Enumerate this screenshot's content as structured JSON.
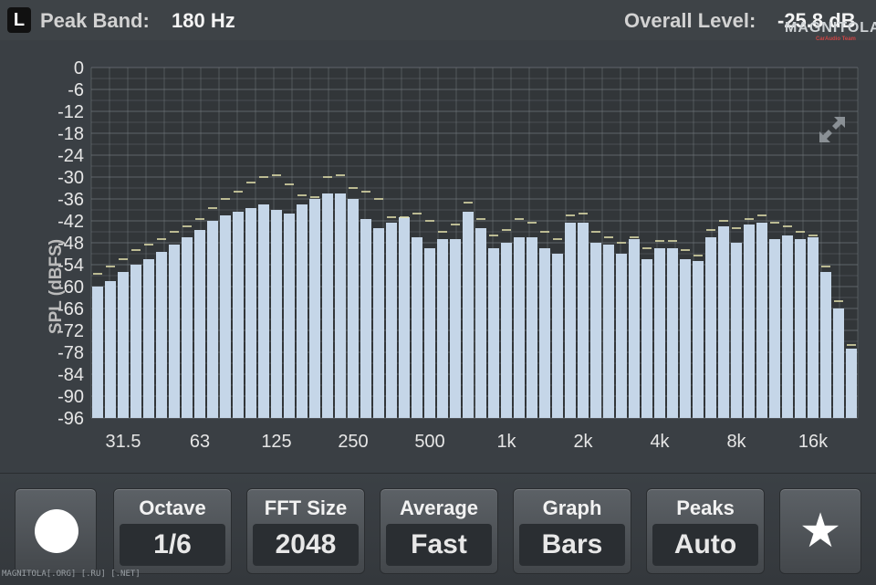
{
  "header": {
    "channel": "L",
    "peak_label": "Peak Band:",
    "peak_value": "180 Hz",
    "level_label": "Overall Level:",
    "level_value": "-25.8 dB",
    "watermark": "MAGNITOLA",
    "watermark_sub": "CarAudio Team"
  },
  "chart_data": {
    "type": "bar",
    "ylabel": "SPL (dBFS)",
    "ylim": [
      -96,
      0
    ],
    "y_ticks": [
      0,
      -6,
      -12,
      -18,
      -24,
      -30,
      -36,
      -42,
      -48,
      -54,
      -60,
      -66,
      -72,
      -78,
      -84,
      -90,
      -96
    ],
    "x_tick_labels": [
      "31.5",
      "63",
      "125",
      "250",
      "500",
      "1k",
      "2k",
      "4k",
      "8k",
      "16k"
    ],
    "x_tick_bar_index": [
      2,
      8,
      14,
      20,
      26,
      32,
      38,
      44,
      50,
      56
    ],
    "grid": true,
    "colors": {
      "bar": "#c5d6e8",
      "peak": "#e9e6b0",
      "grid": "#6e7479",
      "background": "#323639",
      "text": "#e6e6e6"
    },
    "values": [
      -60,
      -58.5,
      -56,
      -54,
      -52.5,
      -50.5,
      -48.5,
      -46.5,
      -44.5,
      -42,
      -40.5,
      -39.5,
      -38.5,
      -37.5,
      -39,
      -40,
      -37.5,
      -36,
      -34.5,
      -34.5,
      -36,
      -41.5,
      -44,
      -42.5,
      -41,
      -46.5,
      -49.5,
      -47,
      -47,
      -39.5,
      -44,
      -49.5,
      -48,
      -46.5,
      -46.5,
      -49.5,
      -51,
      -42.5,
      -42.5,
      -48,
      -48.5,
      -51,
      -47,
      -52.5,
      -49.5,
      -49.5,
      -52.5,
      -53,
      -46.5,
      -43.5,
      -48,
      -43,
      -42.5,
      -47,
      -46,
      -47,
      -46.5,
      -56,
      -66,
      -77
    ],
    "peaks": [
      -56.5,
      -54.5,
      -52.5,
      -50,
      -48.5,
      -47,
      -45,
      -43.5,
      -41.5,
      -38.5,
      -36,
      -34,
      -31.5,
      -30,
      -29.5,
      -32,
      -35,
      -35.5,
      -30,
      -29.5,
      -33,
      -34,
      -36,
      -41,
      -41,
      -40,
      -42,
      -45,
      -43,
      -37,
      -41.5,
      -46,
      -44.5,
      -41.5,
      -42.5,
      -45,
      -47,
      -40.5,
      -40,
      -45,
      -46.5,
      -48,
      -46.5,
      -49.5,
      -47.5,
      -47.5,
      -50,
      -51.5,
      -44.5,
      -42,
      -44,
      -41.5,
      -40.5,
      -42.5,
      -43.5,
      -45,
      -46,
      -54.5,
      -64,
      -76
    ]
  },
  "toolbar": {
    "record_icon": "record-dot",
    "octave_label": "Octave",
    "octave_value": "1/6",
    "fft_label": "FFT Size",
    "fft_value": "2048",
    "average_label": "Average",
    "average_value": "Fast",
    "graph_label": "Graph",
    "graph_value": "Bars",
    "peaks_label": "Peaks",
    "peaks_value": "Auto",
    "favorite_icon": "star"
  },
  "footer": {
    "watermark": "MAGNITOLA[.ORG] [.RU] [.NET]"
  }
}
